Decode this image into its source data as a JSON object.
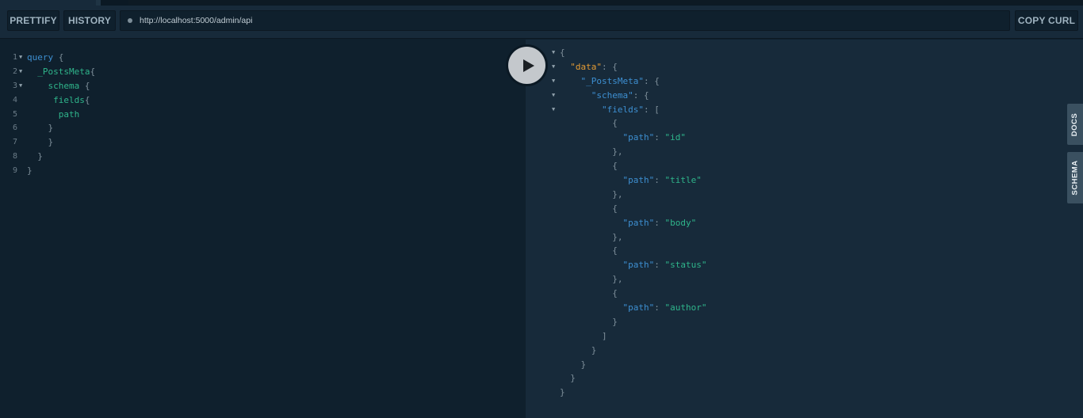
{
  "toolbar": {
    "prettify_label": "PRETTIFY",
    "history_label": "HISTORY",
    "url": "http://localhost:5000/admin/api",
    "copy_curl_label": "COPY CURL"
  },
  "editor": {
    "lines": [
      {
        "n": "1",
        "parts": [
          [
            "kw",
            "query"
          ],
          [
            "pun",
            " {"
          ]
        ]
      },
      {
        "n": "2",
        "parts": [
          [
            "fld",
            "  _PostsMeta"
          ],
          [
            "pun",
            "{"
          ]
        ]
      },
      {
        "n": "3",
        "parts": [
          [
            "fld",
            "    schema"
          ],
          [
            "pun",
            " {"
          ]
        ]
      },
      {
        "n": "4",
        "parts": [
          [
            "fld",
            "     fields"
          ],
          [
            "pun",
            "{"
          ]
        ]
      },
      {
        "n": "5",
        "parts": [
          [
            "fld",
            "      path"
          ]
        ]
      },
      {
        "n": "6",
        "parts": [
          [
            "pun",
            "    }"
          ]
        ]
      },
      {
        "n": "7",
        "parts": [
          [
            "pun",
            "    }"
          ]
        ]
      },
      {
        "n": "8",
        "parts": [
          [
            "pun",
            "  }"
          ]
        ]
      },
      {
        "n": "9",
        "parts": [
          [
            "pun",
            "}"
          ]
        ]
      }
    ]
  },
  "result": {
    "lines": [
      {
        "parts": [
          [
            "pun",
            "{"
          ]
        ]
      },
      {
        "parts": [
          [
            "k-data",
            "  \"data\""
          ],
          [
            "pun",
            ": {"
          ]
        ]
      },
      {
        "parts": [
          [
            "k",
            "    \"_PostsMeta\""
          ],
          [
            "pun",
            ": {"
          ]
        ]
      },
      {
        "parts": [
          [
            "k",
            "      \"schema\""
          ],
          [
            "pun",
            ": {"
          ]
        ]
      },
      {
        "parts": [
          [
            "k",
            "        \"fields\""
          ],
          [
            "pun",
            ": ["
          ]
        ]
      },
      {
        "parts": [
          [
            "pun",
            "          {"
          ]
        ]
      },
      {
        "parts": [
          [
            "k",
            "            \"path\""
          ],
          [
            "pun",
            ": "
          ],
          [
            "v",
            "\"id\""
          ]
        ]
      },
      {
        "parts": [
          [
            "pun",
            "          },"
          ]
        ]
      },
      {
        "parts": [
          [
            "pun",
            "          {"
          ]
        ]
      },
      {
        "parts": [
          [
            "k",
            "            \"path\""
          ],
          [
            "pun",
            ": "
          ],
          [
            "v",
            "\"title\""
          ]
        ]
      },
      {
        "parts": [
          [
            "pun",
            "          },"
          ]
        ]
      },
      {
        "parts": [
          [
            "pun",
            "          {"
          ]
        ]
      },
      {
        "parts": [
          [
            "k",
            "            \"path\""
          ],
          [
            "pun",
            ": "
          ],
          [
            "v",
            "\"body\""
          ]
        ]
      },
      {
        "parts": [
          [
            "pun",
            "          },"
          ]
        ]
      },
      {
        "parts": [
          [
            "pun",
            "          {"
          ]
        ]
      },
      {
        "parts": [
          [
            "k",
            "            \"path\""
          ],
          [
            "pun",
            ": "
          ],
          [
            "v",
            "\"status\""
          ]
        ]
      },
      {
        "parts": [
          [
            "pun",
            "          },"
          ]
        ]
      },
      {
        "parts": [
          [
            "pun",
            "          {"
          ]
        ]
      },
      {
        "parts": [
          [
            "k",
            "            \"path\""
          ],
          [
            "pun",
            ": "
          ],
          [
            "v",
            "\"author\""
          ]
        ]
      },
      {
        "parts": [
          [
            "pun",
            "          }"
          ]
        ]
      },
      {
        "parts": [
          [
            "pun",
            "        ]"
          ]
        ]
      },
      {
        "parts": [
          [
            "pun",
            "      }"
          ]
        ]
      },
      {
        "parts": [
          [
            "pun",
            "    }"
          ]
        ]
      },
      {
        "parts": [
          [
            "pun",
            "  }"
          ]
        ]
      },
      {
        "parts": [
          [
            "pun",
            "}"
          ]
        ]
      }
    ]
  },
  "side_tabs": {
    "docs_label": "DOCS",
    "schema_label": "SCHEMA"
  },
  "icons": {
    "run": "play-icon",
    "url_status": "dot-icon",
    "fold": "caret-down-icon"
  }
}
